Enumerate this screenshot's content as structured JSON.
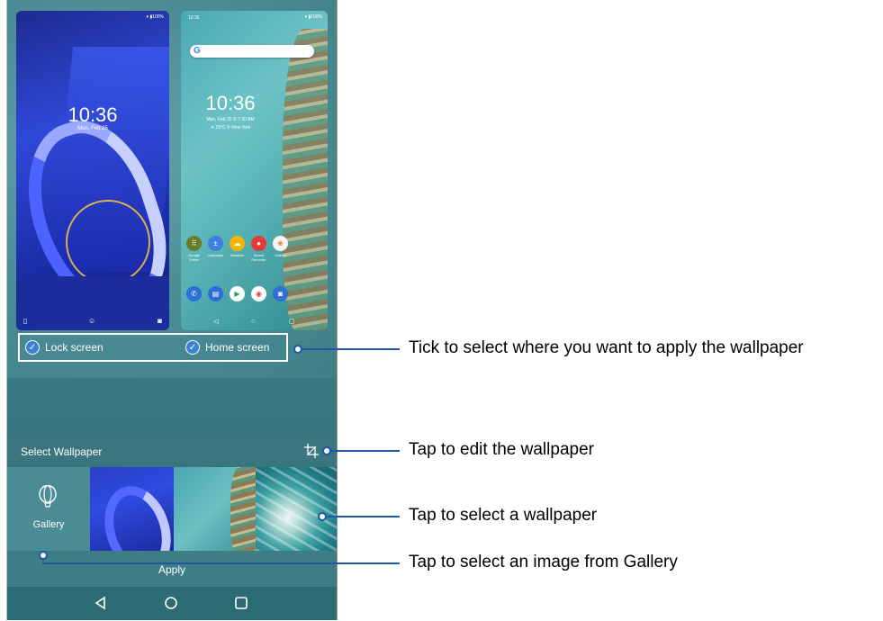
{
  "lock_preview": {
    "status": "▾ ▮100%",
    "time": "10:36",
    "date": "Mon, Feb 25"
  },
  "home_preview": {
    "status_left": "10:36",
    "status_right": "▾ ▮100%",
    "search_logo": "G",
    "time": "10:36",
    "date": "Mon, Feb 25  ⏱ 7:30 AM",
    "weather": "☀ 25°C  ⚲ New York",
    "apps_row1": [
      {
        "label": "Google Folder",
        "color": "#6a7d2a",
        "icon": "google-folder-icon",
        "glyph": "⠿"
      },
      {
        "label": "Calculator",
        "color": "#3f7fe0",
        "icon": "calculator-icon",
        "glyph": "±"
      },
      {
        "label": "Weather",
        "color": "#f4b400",
        "icon": "weather-icon",
        "glyph": "☁"
      },
      {
        "label": "Sound Recorder",
        "color": "#e53935",
        "icon": "microphone-icon",
        "glyph": "●"
      },
      {
        "label": "Gallery",
        "color": "#f5f5f5",
        "icon": "gallery-app-icon",
        "glyph": "❀"
      }
    ],
    "apps_row2": [
      {
        "label": "",
        "color": "#2c6fd6",
        "icon": "phone-icon",
        "glyph": "✆"
      },
      {
        "label": "",
        "color": "#2c6fd6",
        "icon": "messages-icon",
        "glyph": "▤"
      },
      {
        "label": "",
        "color": "#ffffff",
        "icon": "play-store-icon",
        "glyph": "▶"
      },
      {
        "label": "",
        "color": "#ffffff",
        "icon": "chrome-icon",
        "glyph": "◉"
      },
      {
        "label": "",
        "color": "#2c6fd6",
        "icon": "camera-icon",
        "glyph": "◙"
      }
    ]
  },
  "checkboxes": {
    "lock": "Lock screen",
    "home": "Home screen"
  },
  "select_wallpaper": {
    "label": "Select Wallpaper"
  },
  "gallery": {
    "label": "Gallery"
  },
  "apply": {
    "label": "Apply"
  },
  "callouts": {
    "apply_where": "Tick to select where you want to apply the wallpaper",
    "edit": "Tap to edit the wallpaper",
    "select": "Tap to select a wallpaper",
    "gallery": "Tap to select an image from Gallery"
  },
  "colors": {
    "accent": "#3b82d6",
    "callout_line": "#1f57a5"
  }
}
